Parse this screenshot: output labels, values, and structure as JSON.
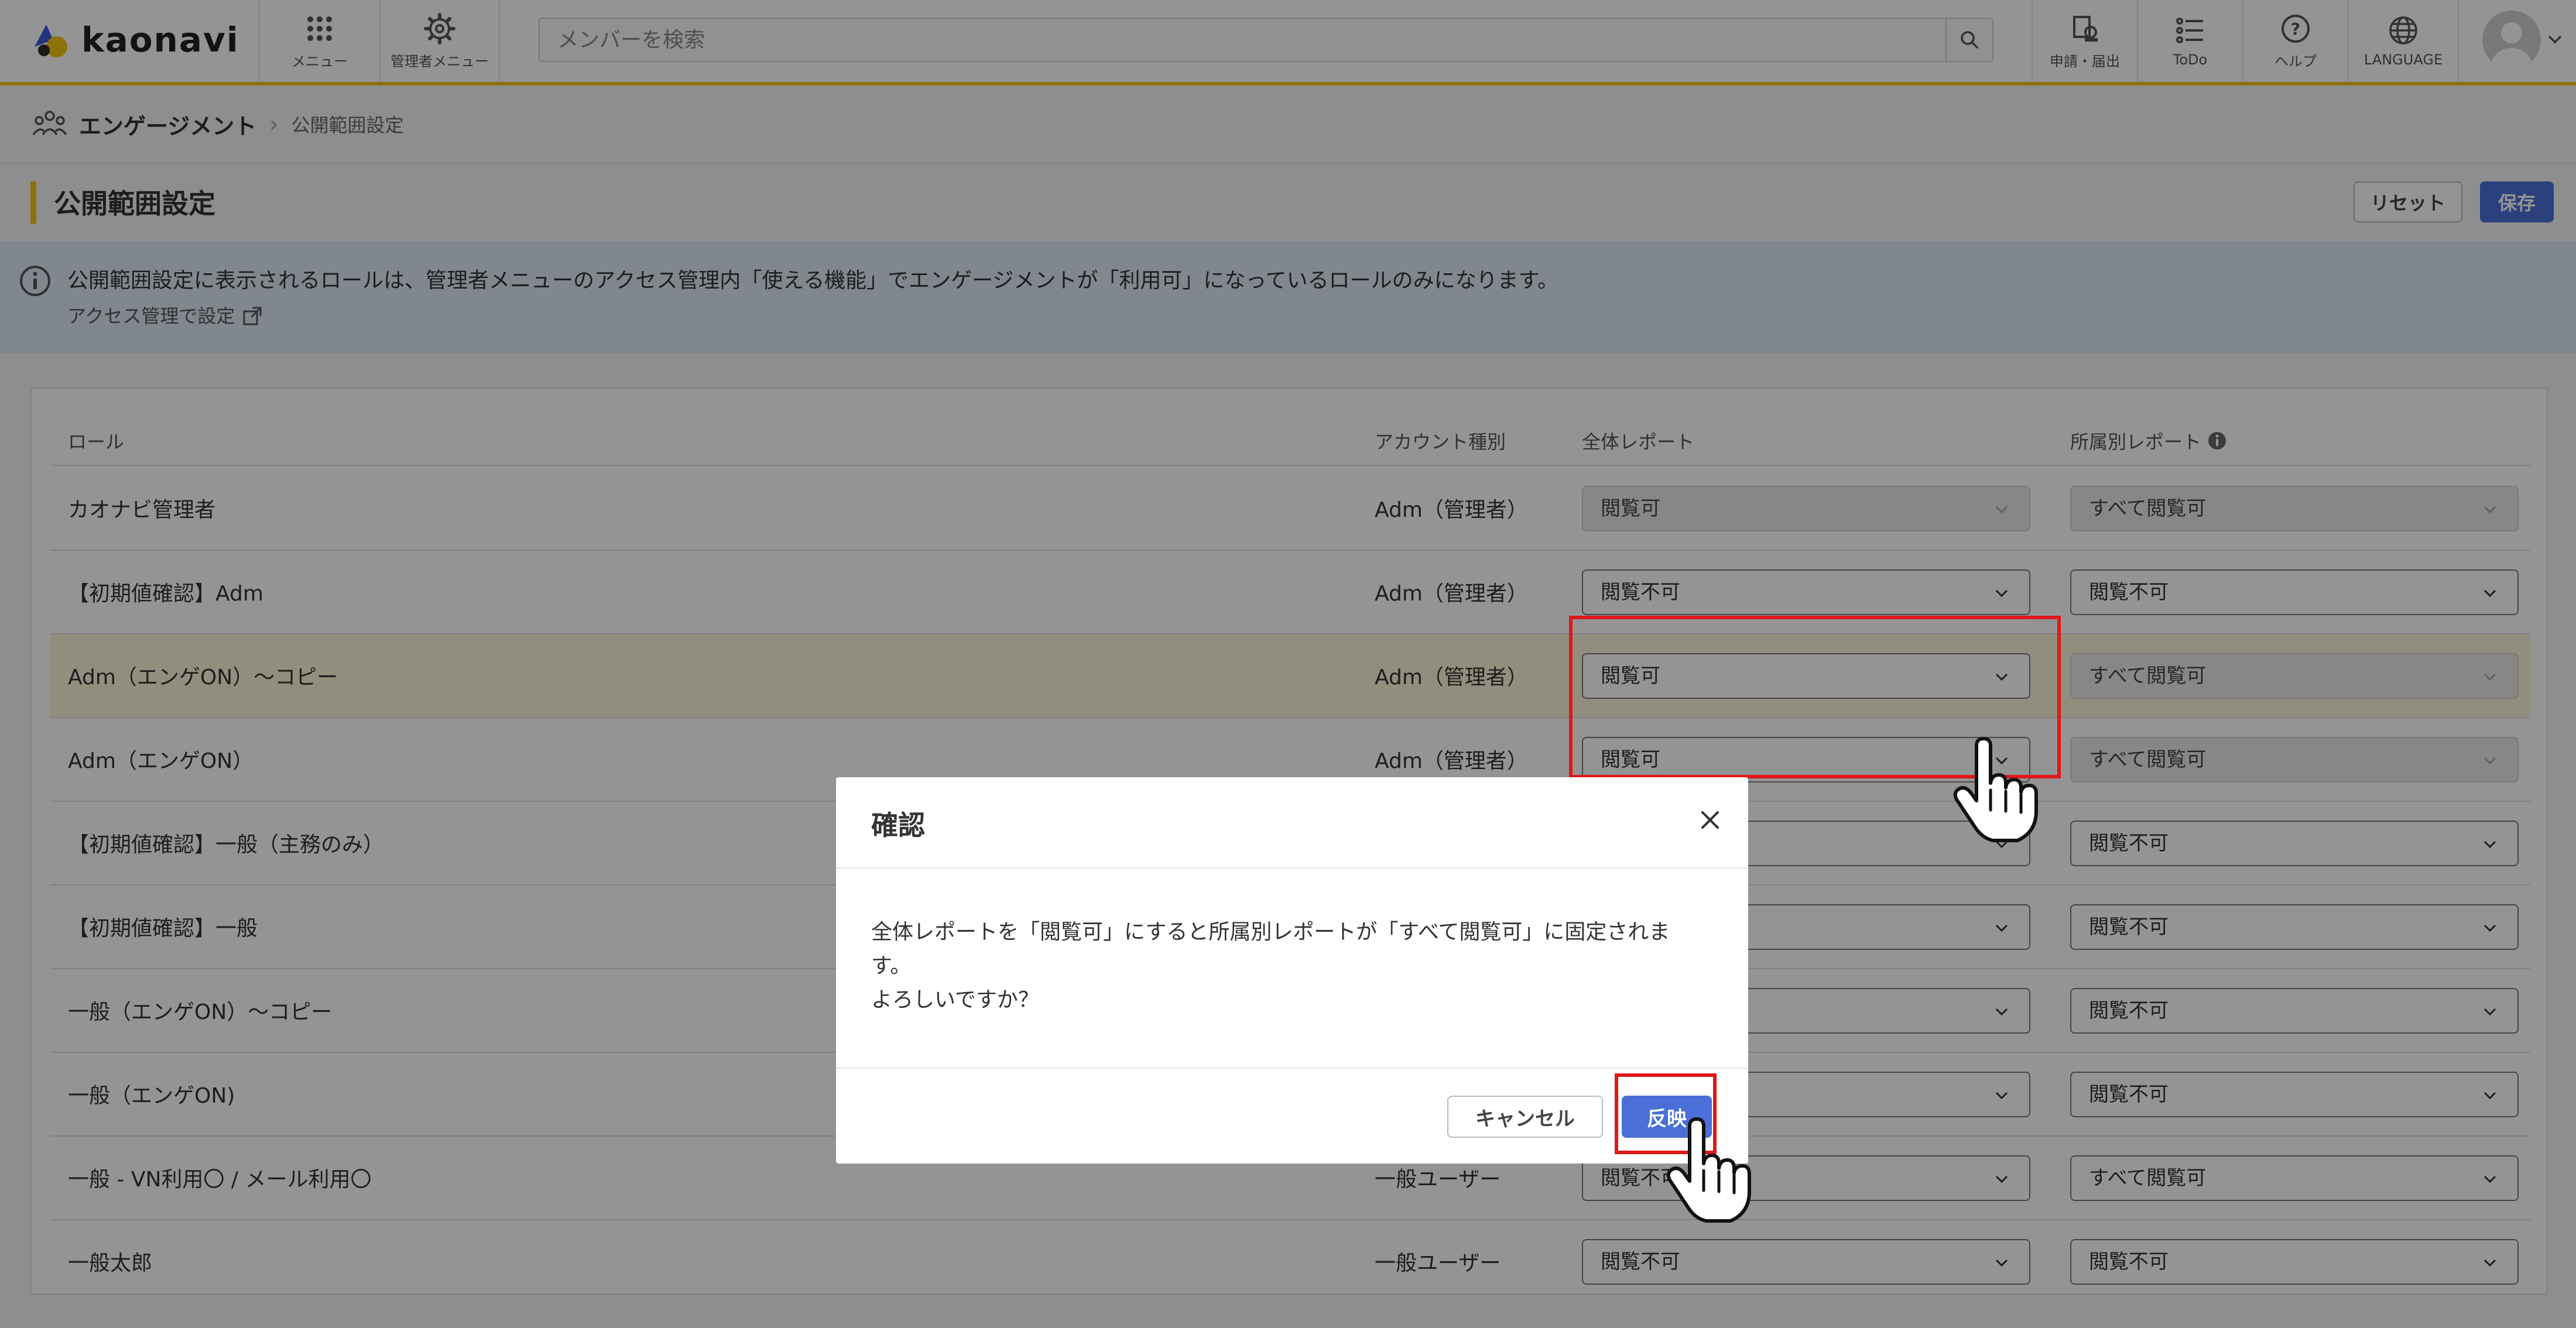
{
  "header": {
    "logo_text": "kaonavi",
    "menu_label": "メニュー",
    "admin_menu_label": "管理者メニュー",
    "search_placeholder": "メンバーを検索",
    "apply_label": "申請・届出",
    "todo_label": "ToDo",
    "help_label": "ヘルプ",
    "language_label": "LANGUAGE"
  },
  "breadcrumb": {
    "parent": "エンゲージメント",
    "current": "公開範囲設定"
  },
  "page": {
    "title": "公開範囲設定",
    "reset_label": "リセット",
    "save_label": "保存"
  },
  "info": {
    "message": "公開範囲設定に表示されるロールは、管理者メニューのアクセス管理内「使える機能」でエンゲージメントが「利用可」になっているロールのみになります。",
    "link_label": "アクセス管理で設定"
  },
  "table": {
    "headers": {
      "role": "ロール",
      "account": "アカウント種別",
      "overall": "全体レポート",
      "dept": "所属別レポート"
    },
    "rows": [
      {
        "role": "カオナビ管理者",
        "account": "Adm（管理者）",
        "overall": "閲覧可",
        "dept": "すべて閲覧可"
      },
      {
        "role": "【初期値確認】Adm",
        "account": "Adm（管理者）",
        "overall": "閲覧不可",
        "dept": "閲覧不可"
      },
      {
        "role": "Adm（エンゲON）～コピー",
        "account": "Adm（管理者）",
        "overall": "閲覧可",
        "dept": "すべて閲覧可"
      },
      {
        "role": "Adm（エンゲON）",
        "account": "Adm（管理者）",
        "overall": "閲覧可",
        "dept": "すべて閲覧可"
      },
      {
        "role": "【初期値確認】一般（主務のみ）",
        "account": "",
        "overall": "",
        "dept": "閲覧不可"
      },
      {
        "role": "【初期値確認】一般",
        "account": "",
        "overall": "",
        "dept": "閲覧不可"
      },
      {
        "role": "一般（エンゲON）～コピー",
        "account": "",
        "overall": "",
        "dept": "閲覧不可"
      },
      {
        "role": "一般（エンゲON)",
        "account": "",
        "overall": "",
        "dept": "閲覧不可"
      },
      {
        "role": "一般 - VN利用〇 / メール利用〇",
        "account": "一般ユーザー",
        "overall": "閲覧不可",
        "dept": "すべて閲覧可"
      },
      {
        "role": "一般太郎",
        "account": "一般ユーザー",
        "overall": "閲覧不可",
        "dept": "閲覧不可"
      }
    ]
  },
  "modal": {
    "title": "確認",
    "body_line1": "全体レポートを「閲覧可」にすると所属別レポートが「すべて閲覧可」に固定されます。",
    "body_line2": "よろしいですか？",
    "cancel_label": "キャンセル",
    "ok_label": "反映"
  },
  "colors": {
    "accent": "#4a6fd8",
    "brand_yellow": "#f1c40f",
    "highlight_red": "#e01818",
    "info_bg": "#dde8f4",
    "row_highlight": "#faf4d8"
  }
}
